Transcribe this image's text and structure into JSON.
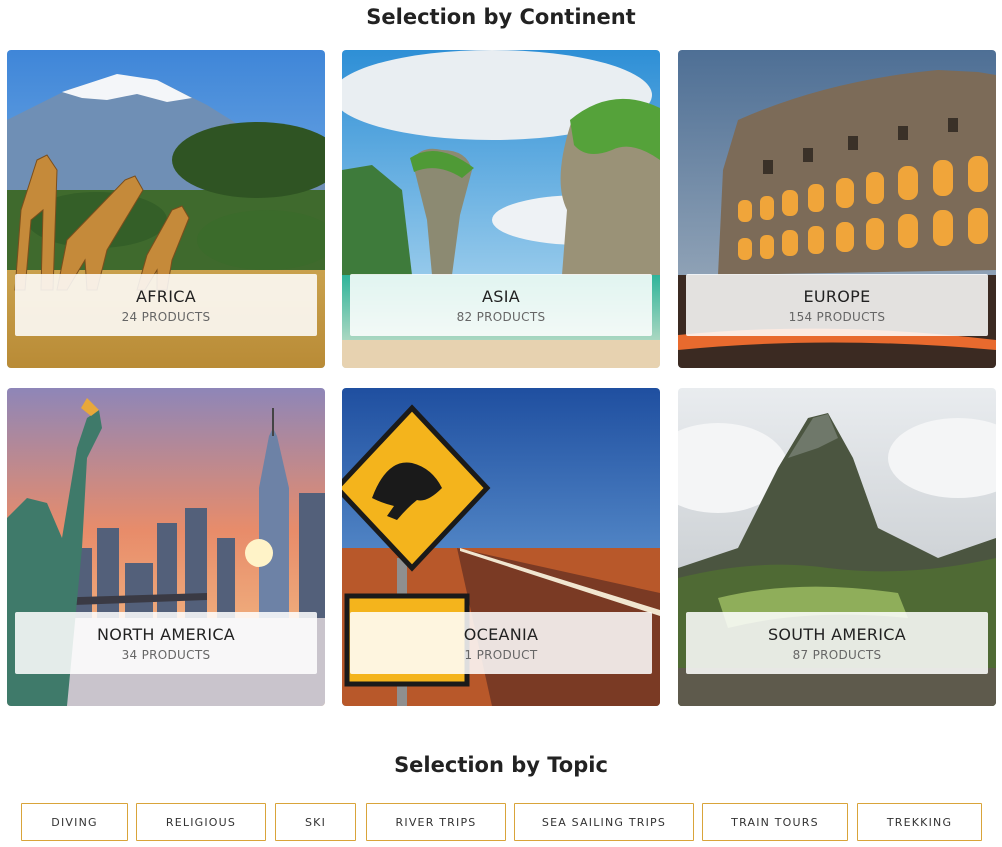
{
  "continent_section": {
    "title": "Selection by Continent",
    "cards": [
      {
        "name": "AFRICA",
        "count": "24 PRODUCTS",
        "icon": "giraffes-savanna-photo"
      },
      {
        "name": "ASIA",
        "count": "82 PRODUCTS",
        "icon": "limestone-island-photo"
      },
      {
        "name": "EUROPE",
        "count": "154 PRODUCTS",
        "icon": "colosseum-photo"
      },
      {
        "name": "NORTH AMERICA",
        "count": "34 PRODUCTS",
        "icon": "statue-of-liberty-skyline-photo"
      },
      {
        "name": "OCEANIA",
        "count": "1 PRODUCT",
        "icon": "kangaroo-road-sign-photo"
      },
      {
        "name": "SOUTH AMERICA",
        "count": "87 PRODUCTS",
        "icon": "machu-picchu-photo"
      }
    ]
  },
  "topic_section": {
    "title": "Selection by Topic",
    "buttons": [
      "DIVING",
      "RELIGIOUS",
      "SKI",
      "RIVER TRIPS",
      "SEA SAILING TRIPS",
      "TRAIN TOURS",
      "TREKKING"
    ]
  },
  "colors": {
    "topic_border": "#d9a43a",
    "label_box": "#ffffff",
    "title_text": "#222222"
  }
}
